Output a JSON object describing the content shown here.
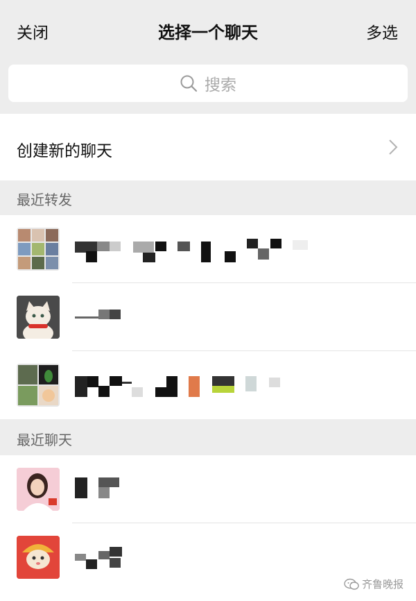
{
  "navbar": {
    "close_label": "关闭",
    "title": "选择一个聊天",
    "multi_select_label": "多选"
  },
  "search": {
    "placeholder": "搜索",
    "icon": "search-icon"
  },
  "new_chat": {
    "label": "创建新的聊天",
    "icon": "chevron-right-icon"
  },
  "sections": {
    "recent_forward": "最近转发",
    "recent_chats": "最近聊天"
  },
  "recent_forward_items": [
    {
      "avatar": "group-photo-grid-avatar",
      "name_obscured": true
    },
    {
      "avatar": "cat-avatar",
      "name_obscured": true
    },
    {
      "avatar": "group-avatar",
      "name_obscured": true
    }
  ],
  "recent_chat_items": [
    {
      "avatar": "woman-portrait-avatar",
      "name_obscured": true
    },
    {
      "avatar": "cat-costume-avatar",
      "name_obscured": true
    }
  ],
  "watermark": {
    "text": "齐鲁晚报"
  },
  "colors": {
    "background": "#ededed",
    "surface": "#ffffff",
    "section_text": "#666666",
    "placeholder": "#aaaaaa"
  }
}
